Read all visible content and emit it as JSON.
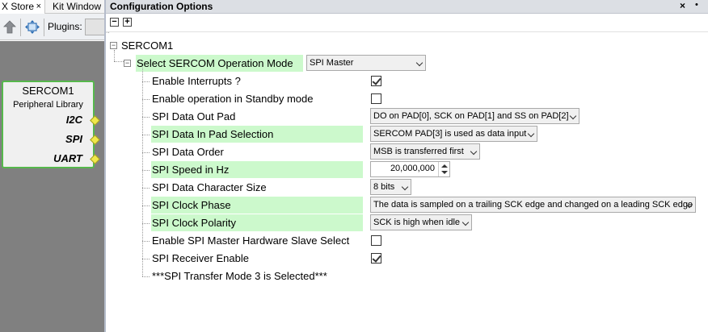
{
  "left_tabs": {
    "store_label": "X Store",
    "kit_label": "Kit Window",
    "close_glyph": "×"
  },
  "toolbar": {
    "plugins_label": "Plugins:"
  },
  "block": {
    "title": "SERCOM1",
    "subtitle": "Peripheral Library",
    "ports": [
      "I2C",
      "SPI",
      "UART"
    ]
  },
  "config": {
    "header_title": "Configuration Options",
    "close_glyph": "×",
    "menu_glyph": "•",
    "collapse_glyph": "−",
    "expand_glyph": "+",
    "tree_toggle_minus": "−",
    "root_label": "SERCOM1",
    "mode_label": "Select SERCOM Operation Mode",
    "mode_value": "SPI Master",
    "options": [
      {
        "label": "Enable Interrupts ?",
        "type": "checkbox",
        "checked": true
      },
      {
        "label": "Enable operation in Standby mode",
        "type": "checkbox",
        "checked": false
      },
      {
        "label": "SPI Data Out Pad",
        "type": "combo",
        "value": "DO on PAD[0], SCK on PAD[1] and SS on PAD[2]"
      },
      {
        "label": "SPI Data In Pad Selection",
        "type": "combo",
        "value": "SERCOM PAD[3] is used as data input",
        "highlight": true
      },
      {
        "label": "SPI Data Order",
        "type": "combo",
        "value": "MSB is transferred first"
      },
      {
        "label": "SPI Speed in Hz",
        "type": "spinner",
        "value": "20,000,000",
        "highlight": true
      },
      {
        "label": "SPI Data Character Size",
        "type": "combo",
        "value": "8 bits"
      },
      {
        "label": "SPI Clock Phase",
        "type": "combo",
        "value": "The data is sampled on a trailing SCK edge and changed on a leading SCK edge",
        "highlight": true
      },
      {
        "label": "SPI Clock Polarity",
        "type": "combo",
        "value": "SCK is high when idle",
        "highlight": true
      },
      {
        "label": "Enable SPI Master Hardware Slave Select",
        "type": "checkbox",
        "checked": false
      },
      {
        "label": "SPI Receiver Enable",
        "type": "checkbox",
        "checked": true
      },
      {
        "label": "***SPI Transfer Mode 3 is Selected***",
        "type": "comment"
      }
    ]
  },
  "colors": {
    "highlight": "#ccf9cc",
    "block_border": "#56b84c",
    "canvas": "#808080",
    "port_diamond": "#f0e84a"
  },
  "icons": {
    "up": "up-arrow-icon",
    "fit": "fit-to-window-icon"
  }
}
